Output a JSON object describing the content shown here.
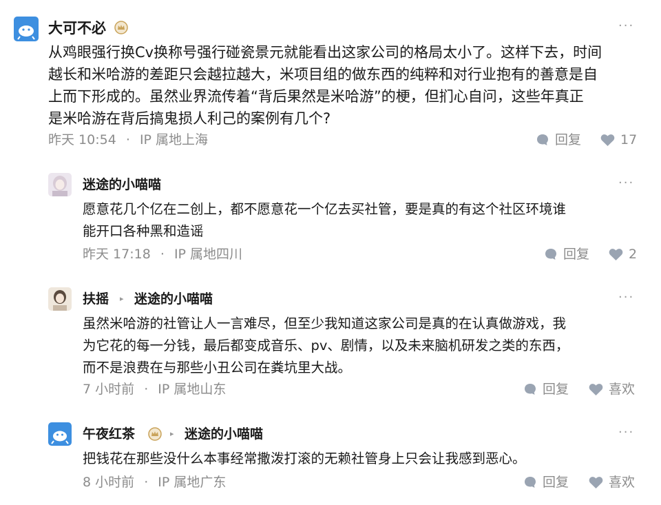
{
  "comments": [
    {
      "author": "大可不必",
      "text_lines": [
        "从鸡眼强行换Cv换称号强行碰瓷景元就能看出这家公司的格局太小了。这样下去，时间",
        "越长和米哈游的差距只会越拉越大，米项目组的做东西的纯粹和对行业抱有的善意是自",
        "上而下形成的。虽然业界流传着“背后果然是米哈游”的梗，但扪心自问，这些年真正",
        "是米哈游在背后搞鬼损人利己的案例有几个?"
      ],
      "time": "昨天 10:54",
      "location": "IP 属地上海",
      "reply_label": "回复",
      "like_label": "17"
    },
    {
      "author": "迷途的小喵喵",
      "text_lines": [
        "愿意花几个亿在二创上，都不愿意花一个亿去买社管，要是真的有这个社区环境谁",
        "能开口各种黑和造谣"
      ],
      "time": "昨天 17:18",
      "location": "IP 属地四川",
      "reply_label": "回复",
      "like_label": "2"
    },
    {
      "author": "扶摇",
      "reply_to": "迷途的小喵喵",
      "text_lines": [
        "虽然米哈游的社管让人一言难尽，但至少我知道这家公司是真的在认真做游戏，我",
        "为它花的每一分钱，最后都变成音乐、pv、剧情，以及未来脑机研发之类的东西，",
        "而不是浪费在与那些小丑公司在粪坑里大战。"
      ],
      "time": "7 小时前",
      "location": "IP 属地山东",
      "reply_label": "回复",
      "like_label": "喜欢"
    },
    {
      "author": "午夜红茶",
      "reply_to": "迷途的小喵喵",
      "text_lines": [
        "把钱花在那些没什么本事经常撒泼打滚的无赖社管身上只会让我感到恶心。"
      ],
      "time": "8 小时前",
      "location": "IP 属地广东",
      "reply_label": "回复",
      "like_label": "喜欢"
    }
  ],
  "separator": "·",
  "more_glyph": "···",
  "reply_arrow_glyph": "▸",
  "colors": {
    "text": "#1a1a1a",
    "meta": "#8c8c8c",
    "icon": "#9aa4b2",
    "avatar_blue": "#3d8fe0",
    "badge": "#c9a35a"
  }
}
